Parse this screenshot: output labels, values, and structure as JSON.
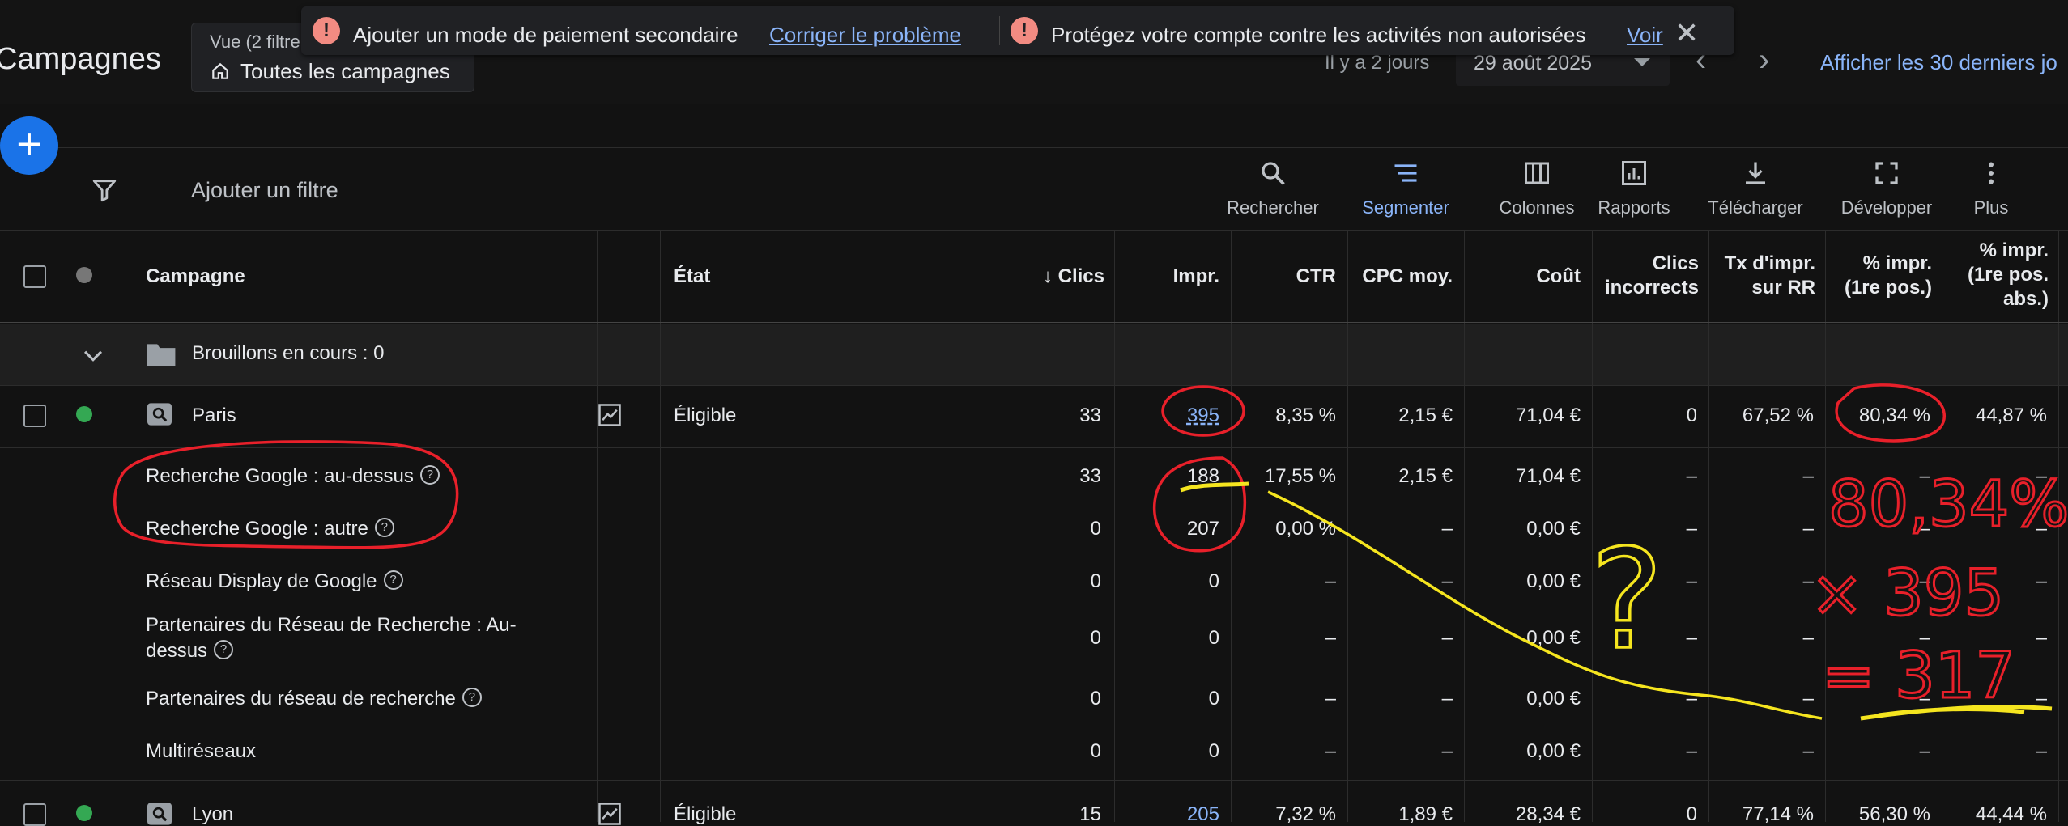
{
  "header": {
    "page_title": "Campagnes",
    "view_label": "Vue (2 filtre",
    "view_value": "Toutes les campagnes",
    "date_ago": "Il y a 2 jours",
    "date_value": "29 août 2025",
    "show_last": "Afficher les 30 derniers jo"
  },
  "notifications": {
    "msg1": "Ajouter un mode de paiement secondaire",
    "link1": "Corriger le problème",
    "msg2": "Protégez votre compte contre les activités non autorisées",
    "link2": "Voir",
    "alert_glyph": "!"
  },
  "fab_label": "+",
  "filter": {
    "placeholder": "Ajouter un filtre"
  },
  "toolbar": [
    {
      "label": "Rechercher",
      "icon": "search-icon"
    },
    {
      "label": "Segmenter",
      "icon": "segment-icon"
    },
    {
      "label": "Colonnes",
      "icon": "columns-icon"
    },
    {
      "label": "Rapports",
      "icon": "reports-icon"
    },
    {
      "label": "Télécharger",
      "icon": "download-icon"
    },
    {
      "label": "Développer",
      "icon": "expand-icon"
    },
    {
      "label": "Plus",
      "icon": "more-icon"
    }
  ],
  "columns": {
    "campaign": "Campagne",
    "status": "État",
    "clicks": "Clics",
    "impr": "Impr.",
    "ctr": "CTR",
    "cpc": "CPC moy.",
    "cost": "Coût",
    "invalid_l1": "Clics",
    "invalid_l2": "incorrects",
    "rr_l1": "Tx d'impr.",
    "rr_l2": "sur RR",
    "top_l1": "% impr.",
    "top_l2": "(1re pos.)",
    "abs_l1": "% impr.",
    "abs_l2": "(1re pos.",
    "abs_l3": "abs.)"
  },
  "drafts": {
    "label": "Brouillons en cours : 0"
  },
  "paris": {
    "name": "Paris",
    "status": "Éligible",
    "clicks": "33",
    "impr": "395",
    "ctr": "8,35 %",
    "cpc": "2,15 €",
    "cost": "71,04 €",
    "invalid": "0",
    "rr": "67,52 %",
    "top": "80,34 %",
    "abs": "44,87 %"
  },
  "segments": [
    {
      "label": "Recherche Google : au-dessus",
      "clicks": "33",
      "impr": "188",
      "ctr": "17,55 %",
      "cpc": "2,15 €",
      "cost": "71,04 €",
      "invalid": "–",
      "rr": "–",
      "top": "–",
      "abs": "–"
    },
    {
      "label": "Recherche Google : autre",
      "clicks": "0",
      "impr": "207",
      "ctr": "0,00 %",
      "cpc": "–",
      "cost": "0,00 €",
      "invalid": "–",
      "rr": "–",
      "top": "–",
      "abs": "–"
    },
    {
      "label": "Réseau Display de Google",
      "clicks": "0",
      "impr": "0",
      "ctr": "–",
      "cpc": "–",
      "cost": "0,00 €",
      "invalid": "–",
      "rr": "–",
      "top": "–",
      "abs": "–"
    },
    {
      "label_l1": "Partenaires du Réseau de Recherche : Au-",
      "label_l2": "dessus",
      "clicks": "0",
      "impr": "0",
      "ctr": "–",
      "cpc": "–",
      "cost": "0,00 €",
      "invalid": "–",
      "rr": "–",
      "top": "–",
      "abs": "–"
    },
    {
      "label": "Partenaires du réseau de recherche",
      "clicks": "0",
      "impr": "0",
      "ctr": "–",
      "cpc": "–",
      "cost": "0,00 €",
      "invalid": "–",
      "rr": "–",
      "top": "–",
      "abs": "–"
    },
    {
      "label": "Multiréseaux",
      "clicks": "0",
      "impr": "0",
      "ctr": "–",
      "cpc": "–",
      "cost": "0,00 €",
      "invalid": "–",
      "rr": "–",
      "top": "–",
      "abs": "–"
    }
  ],
  "lyon": {
    "name": "Lyon",
    "status": "Éligible",
    "clicks": "15",
    "impr": "205",
    "ctr": "7,32 %",
    "cpc": "1,89 €",
    "cost": "28,34 €",
    "invalid": "0",
    "rr": "77,14 %",
    "top": "56,30 %",
    "abs": "44,44 %"
  },
  "help_glyph": "?",
  "annotations": {
    "calc_l1": "80,34%",
    "calc_l2": "× 395",
    "calc_l3": "= 317",
    "question": "?",
    "red": "#e8202a",
    "yellow": "#f5e51f"
  },
  "colors": {
    "accent": "#8ab4f8",
    "primary": "#1a73e8",
    "eligible": "#34a853",
    "alert": "#f28b82"
  }
}
